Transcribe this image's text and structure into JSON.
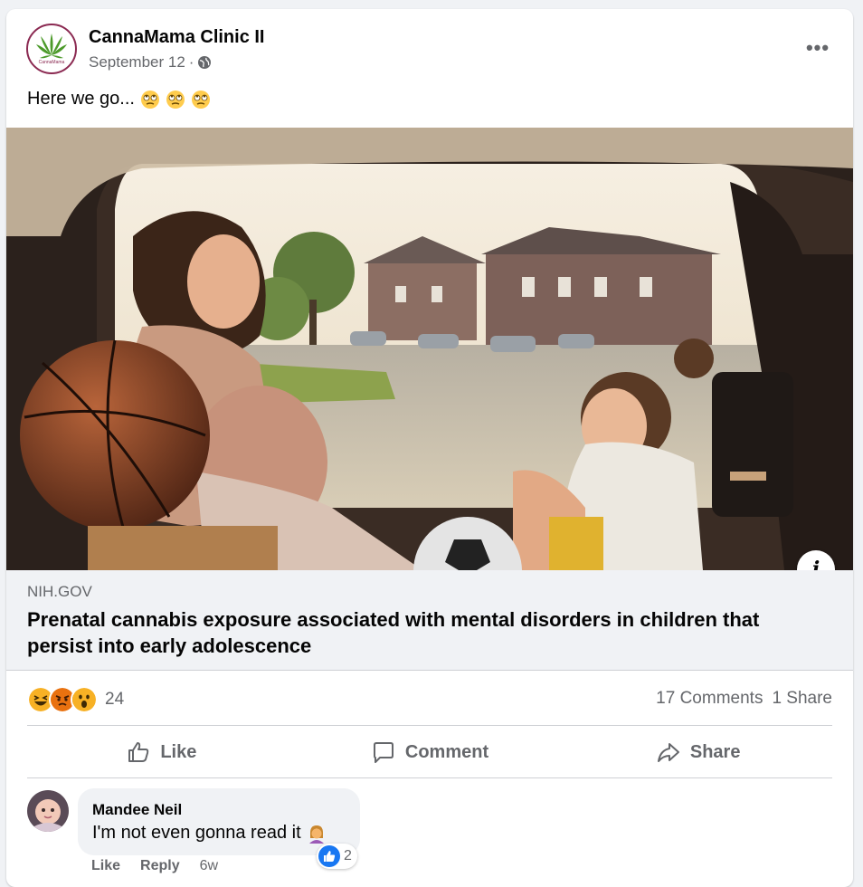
{
  "post": {
    "page_name": "CannaMama Clinic II",
    "date": "September 12",
    "separator": "·",
    "privacy_icon": "globe-icon",
    "more_label": "•••",
    "text": "Here we go...",
    "text_emojis": [
      "rolling-eyes",
      "rolling-eyes",
      "rolling-eyes"
    ]
  },
  "avatar": {
    "logo_text": "CannaMama"
  },
  "link_preview": {
    "domain": "NIH.GOV",
    "title": "Prenatal cannabis exposure associated with mental disorders in children that persist into early adolescence",
    "info_label": "i"
  },
  "engagement": {
    "reaction_types": [
      "haha",
      "angry",
      "wow"
    ],
    "reaction_count": "24",
    "comments": "17 Comments",
    "shares": "1 Share"
  },
  "actions": {
    "like": "Like",
    "comment": "Comment",
    "share": "Share"
  },
  "comment": {
    "author": "Mandee Neil",
    "text": "I'm not even gonna read it",
    "reaction_count": "2",
    "like": "Like",
    "reply": "Reply",
    "time": "6w"
  },
  "colors": {
    "background": "#f0f2f5",
    "card": "#ffffff",
    "secondary_text": "#65676b",
    "like_blue": "#1877f2",
    "angry": "#e9710f",
    "haha": "#f7b125"
  }
}
